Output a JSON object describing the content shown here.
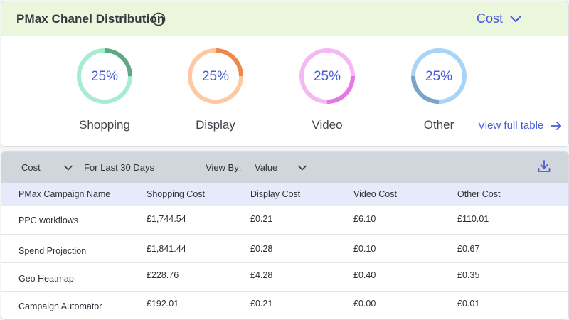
{
  "header": {
    "title": "PMax Chanel Distribution",
    "info_icon": "info-circle-icon",
    "metric_selector": {
      "value": "Cost",
      "icon": "chevron-down-icon"
    }
  },
  "channels": [
    {
      "label": "Shopping",
      "percent_label": "25%",
      "share": 0.25,
      "ring_color": "#a6ecd0",
      "segment_color": "#5ea887"
    },
    {
      "label": "Display",
      "percent_label": "25%",
      "share": 0.25,
      "ring_color": "#fcc9a3",
      "segment_color": "#ec8a4e"
    },
    {
      "label": "Video",
      "percent_label": "25%",
      "share": 0.25,
      "ring_color": "#f4b8f2",
      "segment_color": "#e776e6"
    },
    {
      "label": "Other",
      "percent_label": "25%",
      "share": 0.25,
      "ring_color": "#a8d5f6",
      "segment_color": "#7aa3c7"
    }
  ],
  "view_full_table": {
    "label": "View full table",
    "icon": "arrow-right-icon"
  },
  "toolbar": {
    "metric": "Cost",
    "metric_icon": "chevron-down-icon",
    "period": "For Last 30 Days",
    "view_by_label": "View By:",
    "view_by_value": "Value",
    "view_by_icon": "chevron-down-icon",
    "download_icon": "download-icon"
  },
  "table": {
    "columns": [
      "PMax Campaign Name",
      "Shopping Cost",
      "Display Cost",
      "Video Cost",
      "Other Cost"
    ],
    "rows": [
      [
        "PPC workflows",
        "£1,744.54",
        "£0.21",
        "£6.10",
        "£110.01"
      ],
      [
        "Spend Projection",
        "£1,841.44",
        "£0.28",
        "£0.10",
        "£0.67"
      ],
      [
        "Geo Heatmap",
        "£228.76",
        "£4.28",
        "£0.40",
        "£0.35"
      ],
      [
        "Campaign Automator",
        "£192.01",
        "£0.21",
        "£0.00",
        "£0.01"
      ]
    ]
  },
  "colors": {
    "accent": "#4a5ad7",
    "header_bg": "#eaf7dc",
    "toolbar_bg": "#d1d6dc",
    "table_header_bg": "#e6eafb"
  }
}
